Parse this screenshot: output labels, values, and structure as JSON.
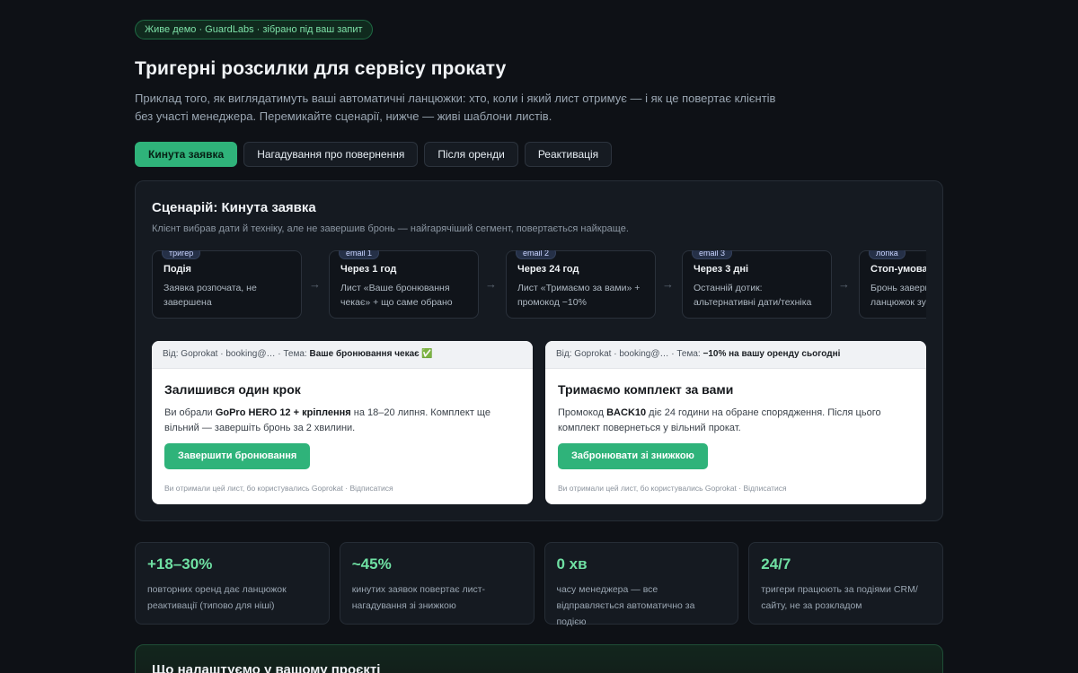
{
  "badge": "Живе демо · GuardLabs · зібрано під ваш запит",
  "title": "Тригерні розсилки для сервісу прокату",
  "intro": "Приклад того, як виглядатимуть ваші автоматичні ланцюжки: хто, коли і який лист отримує — і як це повертає клієнтів без участі менеджера. Перемикайте сценарії, нижче — живі шаблони листів.",
  "tabs": [
    {
      "label": "Кинута заявка",
      "active": true
    },
    {
      "label": "Нагадування про повернення",
      "active": false
    },
    {
      "label": "Після оренди",
      "active": false
    },
    {
      "label": "Реактивація",
      "active": false
    }
  ],
  "scenario": {
    "title": "Сценарій: Кинута заявка",
    "subtitle": "Клієнт вибрав дати й техніку, але не завершив бронь — найгарячіший сегмент, повертається найкраще.",
    "arrow": "→",
    "steps": [
      {
        "tag": "тригер",
        "title": "Подія",
        "desc": "Заявка розпочата, не завершена"
      },
      {
        "tag": "email 1",
        "title": "Через 1 год",
        "desc": "Лист «Ваше бронювання чекає» + що саме обрано"
      },
      {
        "tag": "email 2",
        "title": "Через 24 год",
        "desc": "Лист «Тримаємо за вами» + промокод −10%"
      },
      {
        "tag": "email 3",
        "title": "Через 3 дні",
        "desc": "Останній дотик: альтернативні дати/техніка"
      },
      {
        "tag": "логіка",
        "title": "Стоп-умова",
        "desc": "Бронь завершено — ланцюжок зупиняється"
      }
    ]
  },
  "emails": [
    {
      "from_label": "Від:",
      "from": "Goprokat · booking@…",
      "subject_label": "· Тема:",
      "subject": "Ваше бронювання чекає ✅",
      "heading": "Залишився один крок",
      "text_1": "Ви обрали ",
      "text_bold": "GoPro HERO 12 + кріплення",
      "text_2": " на 18–20 липня. Комплект ще вільний — завершіть бронь за 2 хвилини.",
      "button": "Завершити бронювання",
      "footer": "Ви отримали цей лист, бо користувались Goprokat · Відписатися"
    },
    {
      "from_label": "Від:",
      "from": "Goprokat · booking@…",
      "subject_label": "· Тема:",
      "subject": "−10% на вашу оренду сьогодні",
      "heading": "Тримаємо комплект за вами",
      "text_1": "Промокод ",
      "text_bold": "BACK10",
      "text_2": " діє 24 години на обране спорядження. Після цього комплект повернеться у вільний прокат.",
      "button": "Забронювати зі знижкою",
      "footer": "Ви отримали цей лист, бо користувались Goprokat · Відписатися"
    }
  ],
  "stats": [
    {
      "value": "+18–30%",
      "label": "повторних оренд дає ланцюжок реактивації (типово для ніші)"
    },
    {
      "value": "~45%",
      "label": "кинутих заявок повертає лист-нагадування зі знижкою"
    },
    {
      "value": "0 хв",
      "label": "часу менеджера — все відправляється автоматично за подією"
    },
    {
      "value": "24/7",
      "label": "тригери працюють за подіями CRM/сайту, не за розкладом"
    }
  ],
  "config": {
    "title": "Що налаштуємо у вашому проєкті"
  },
  "colors": {
    "accent": "#2fb37a",
    "background": "#0e1116",
    "card": "#151a21",
    "stat_value": "#6fe0a3"
  }
}
